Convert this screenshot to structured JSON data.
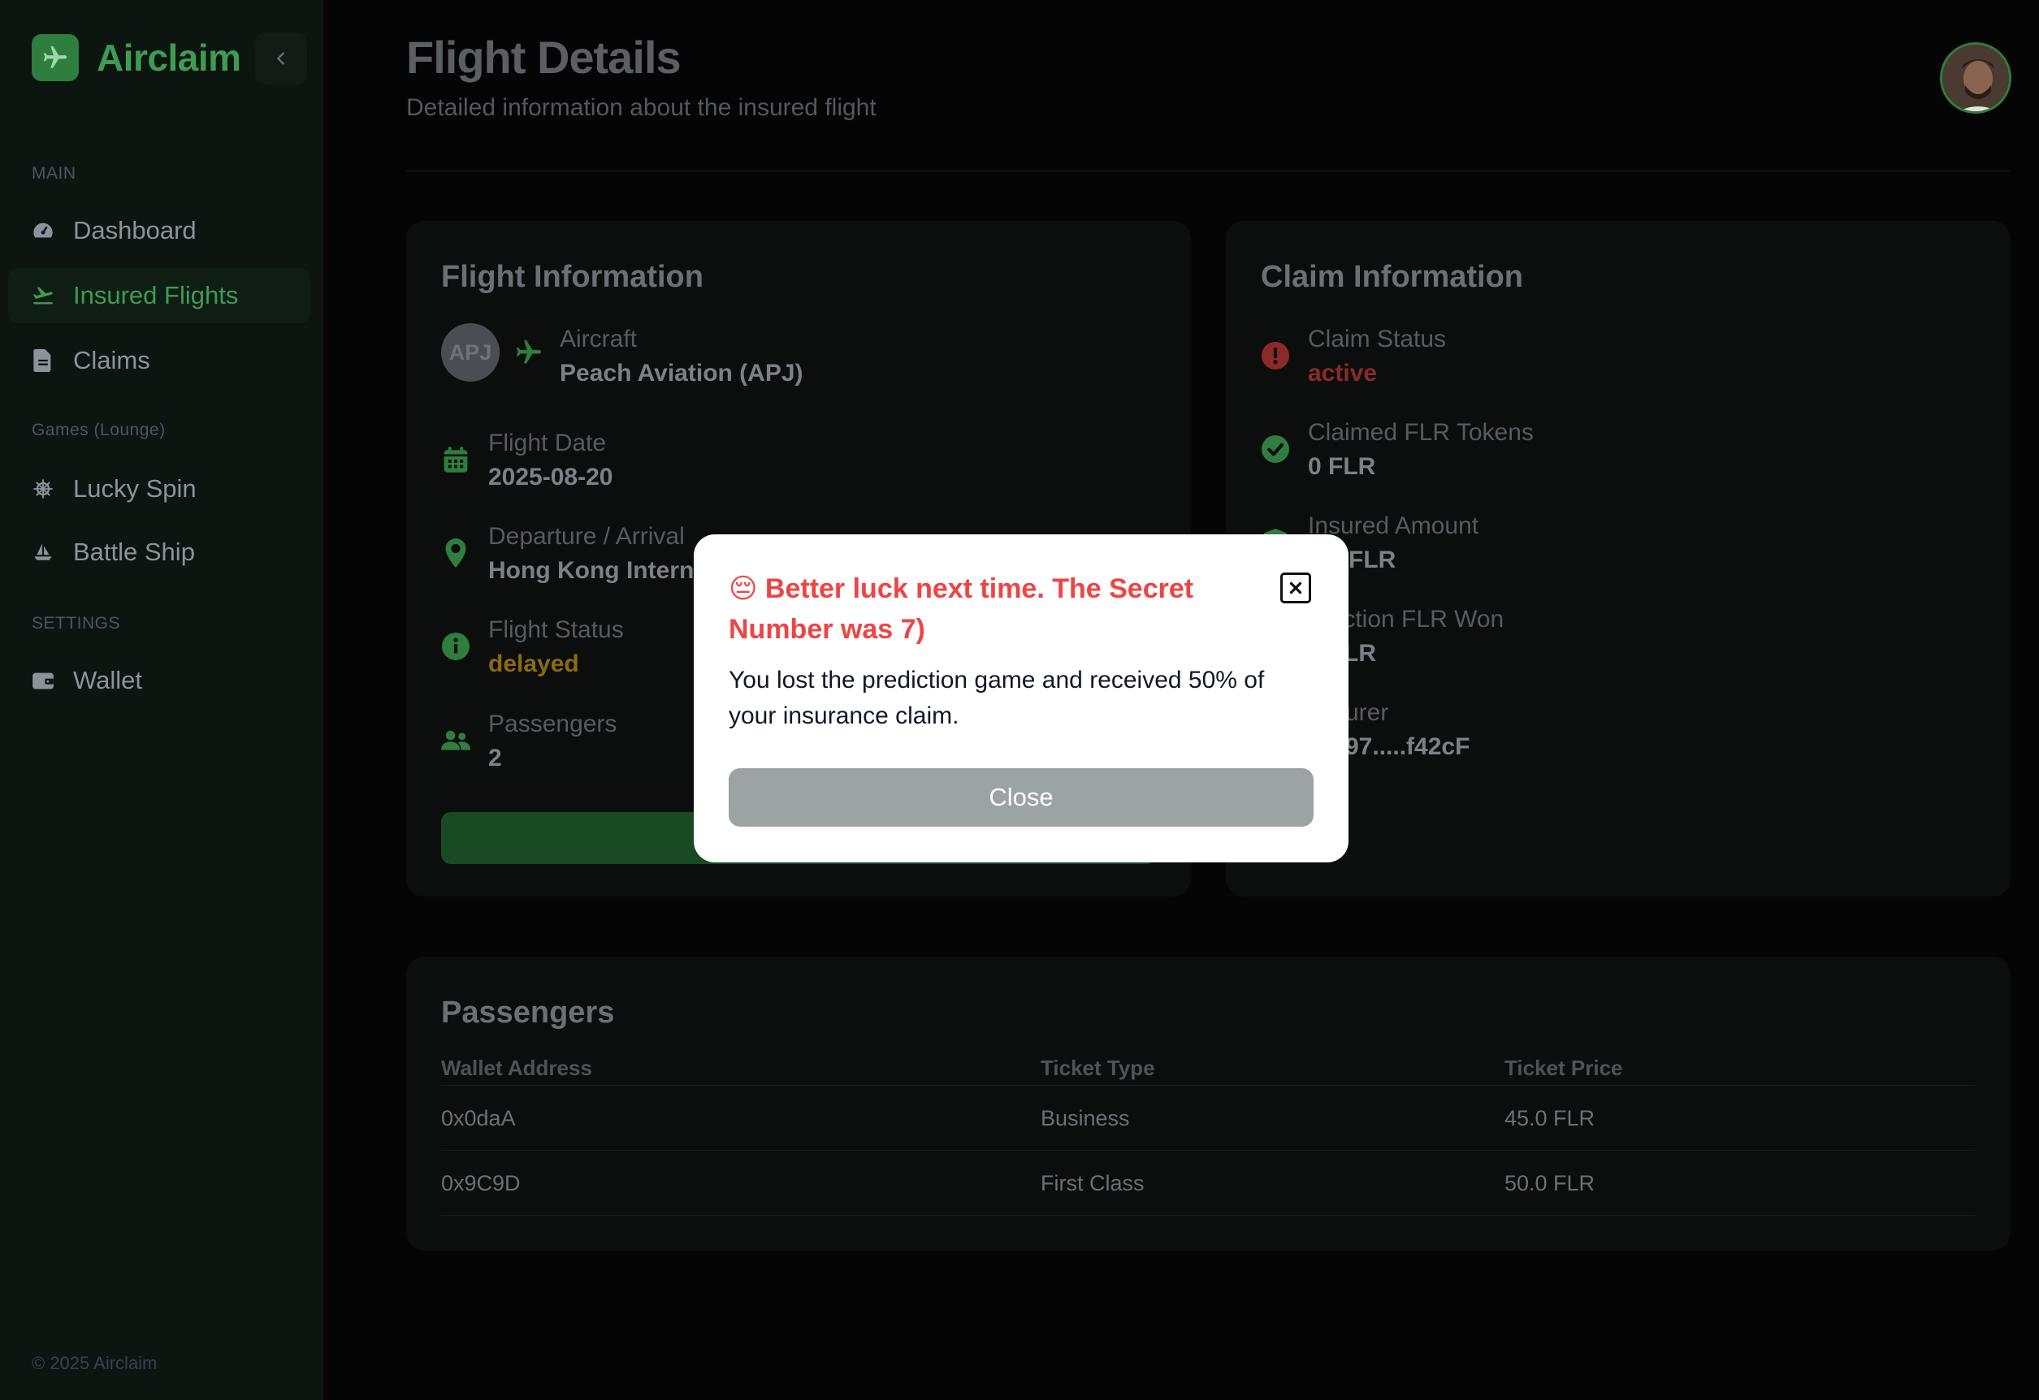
{
  "sidebar": {
    "brand": "Airclaim",
    "sections": {
      "main": "MAIN",
      "games": "Games (Lounge)",
      "settings": "SETTINGS"
    },
    "items": [
      {
        "label": "Dashboard",
        "icon": "gauge-icon"
      },
      {
        "label": "Insured Flights",
        "icon": "plane-departure-icon",
        "active": true
      },
      {
        "label": "Claims",
        "icon": "document-icon"
      },
      {
        "label": "Lucky Spin",
        "icon": "ship-wheel-icon"
      },
      {
        "label": "Battle Ship",
        "icon": "sailboat-icon"
      },
      {
        "label": "Wallet",
        "icon": "wallet-icon"
      }
    ],
    "copyright": "© 2025 Airclaim"
  },
  "header": {
    "title": "Flight Details",
    "subtitle": "Detailed information about the insured flight"
  },
  "flight_info": {
    "title": "Flight Information",
    "aircraft_badge": "APJ",
    "aircraft_label": "Aircraft",
    "aircraft_value": "Peach Aviation (APJ)",
    "date_label": "Flight Date",
    "date_value": "2025-08-20",
    "route_label": "Departure / Arrival",
    "route_value": "Hong Kong Interna",
    "status_label": "Flight Status",
    "status_value": "delayed",
    "passengers_label": "Passengers",
    "passengers_value": "2"
  },
  "claim_info": {
    "title": "Claim Information",
    "claim_status_label": "Claim Status",
    "claim_status_value": "active",
    "claimed_label": "Claimed FLR Tokens",
    "claimed_value": "0 FLR",
    "insured_label": "Insured Amount",
    "insured_value": "FLR",
    "prediction_label": "diction FLR Won",
    "prediction_value": "LR",
    "insurer_label": "urer",
    "insurer_value": "97.....f42cF"
  },
  "passengers": {
    "title": "Passengers",
    "columns": [
      "Wallet Address",
      "Ticket Type",
      "Ticket Price"
    ],
    "rows": [
      [
        "0x0daA",
        "Business",
        "45.0 FLR"
      ],
      [
        "0x9C9D",
        "First Class",
        "50.0 FLR"
      ]
    ]
  },
  "modal": {
    "emoji": "😔",
    "title": "Better luck next time. The Secret Number was 7)",
    "body": "You lost the prediction game and received 50% of your insurance claim.",
    "close_label": "Close"
  },
  "colors": {
    "brand_green": "#3e9b52",
    "error_red": "#ef4444",
    "delayed_amber": "#8a6a12"
  }
}
